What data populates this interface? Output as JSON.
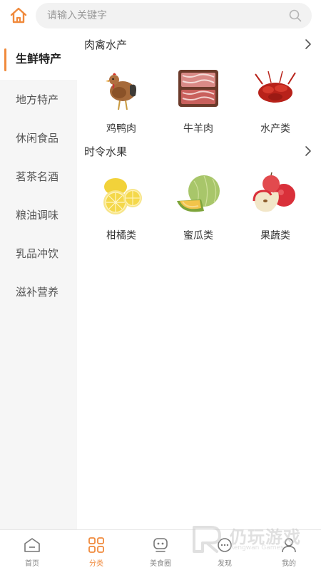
{
  "colors": {
    "accent": "#f08a3c",
    "sidebar_bg": "#f6f6f6",
    "text": "#333333"
  },
  "header": {
    "home_icon": "home-icon",
    "search": {
      "placeholder": "请输入关键字",
      "value": "",
      "icon": "search-icon"
    }
  },
  "sidebar": {
    "items": [
      {
        "label": "生鲜特产",
        "active": true
      },
      {
        "label": "地方特产",
        "active": false
      },
      {
        "label": "休闲食品",
        "active": false
      },
      {
        "label": "茗茶名酒",
        "active": false
      },
      {
        "label": "粮油调味",
        "active": false
      },
      {
        "label": "乳品冲饮",
        "active": false
      },
      {
        "label": "滋补营养",
        "active": false
      }
    ]
  },
  "sections": [
    {
      "title": "肉禽水产",
      "items": [
        {
          "label": "鸡鸭肉",
          "icon": "chicken-icon"
        },
        {
          "label": "牛羊肉",
          "icon": "meat-icon"
        },
        {
          "label": "水产类",
          "icon": "crayfish-icon"
        }
      ]
    },
    {
      "title": "时令水果",
      "items": [
        {
          "label": "柑橘类",
          "icon": "lemon-icon"
        },
        {
          "label": "蜜瓜类",
          "icon": "melon-icon"
        },
        {
          "label": "果蔬类",
          "icon": "apple-icon"
        }
      ]
    }
  ],
  "tabbar": {
    "items": [
      {
        "label": "首页",
        "icon": "home-tab-icon",
        "active": false
      },
      {
        "label": "分类",
        "icon": "category-tab-icon",
        "active": true
      },
      {
        "label": "美食圈",
        "icon": "food-circle-tab-icon",
        "active": false
      },
      {
        "label": "发现",
        "icon": "discover-tab-icon",
        "active": false
      },
      {
        "label": "我的",
        "icon": "profile-tab-icon",
        "active": false
      }
    ]
  },
  "watermark": {
    "text": "仍玩游戏",
    "sub": "Rengwan Games"
  }
}
